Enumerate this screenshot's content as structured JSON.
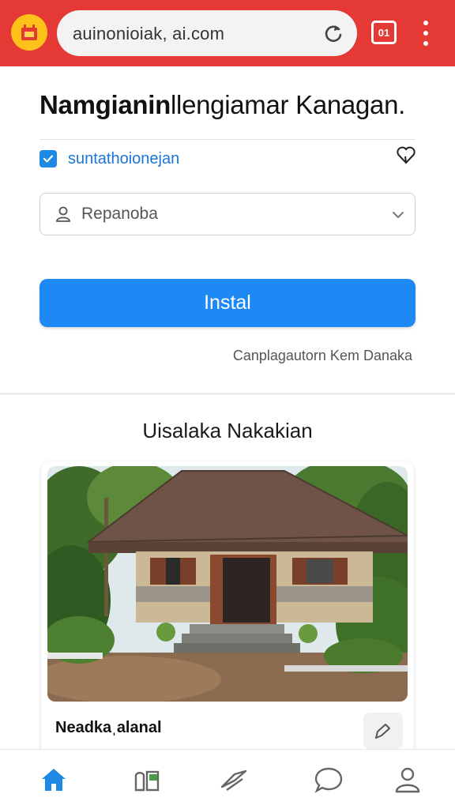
{
  "browser": {
    "url": "auinonioiak, ai.com",
    "tab_count": "01",
    "icons": {
      "app": "app-logo-icon",
      "reload": "reload-icon",
      "tabs": "tabs-icon",
      "menu": "more-vert-icon"
    },
    "colors": {
      "bar": "#e53935",
      "app_icon_bg": "#ffc21a"
    }
  },
  "header": {
    "title_bold": "Namgianin",
    "title_rest": "llengiamar Kanagan."
  },
  "checkbox_row": {
    "label": "suntathoionejan",
    "checked": true,
    "favorite_icon": "heart-icon"
  },
  "select": {
    "value": "Repanoba",
    "icon": "user-icon",
    "chevron": "chevron-down-icon"
  },
  "install_button": {
    "label": "Instal",
    "color": "#1e88f5"
  },
  "secondary_link": "Canplagautorn Kem Danaka",
  "section": {
    "title": "Uisalaka Nakakian"
  },
  "card": {
    "caption": "Neadkaˌalanal",
    "share_icon": "share-icon"
  },
  "bottom_nav": {
    "items": [
      {
        "name": "home",
        "icon": "home-icon",
        "active": true
      },
      {
        "name": "library",
        "icon": "library-icon",
        "active": false
      },
      {
        "name": "explore",
        "icon": "explore-icon",
        "active": false
      },
      {
        "name": "chat",
        "icon": "chat-bubble-icon",
        "active": false
      },
      {
        "name": "profile",
        "icon": "profile-icon",
        "active": false
      }
    ],
    "active_color": "#1e88e5",
    "inactive_color": "#666666"
  }
}
